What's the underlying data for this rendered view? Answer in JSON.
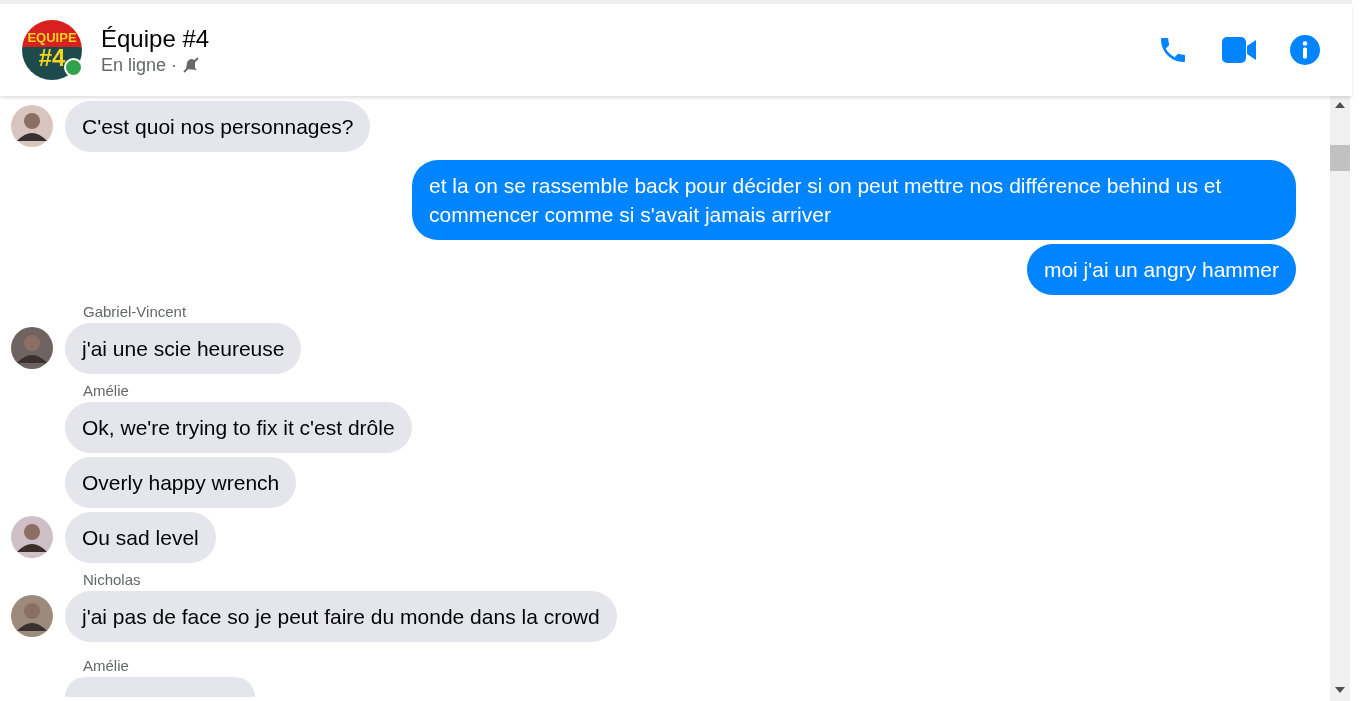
{
  "header": {
    "avatar": {
      "logo_top": "EQUIPE",
      "logo_bottom": "#4",
      "online": true
    },
    "title": "Équipe #4",
    "status": "En ligne ·",
    "muted": true,
    "actions": [
      {
        "kind": "call"
      },
      {
        "kind": "video"
      },
      {
        "kind": "info"
      }
    ]
  },
  "messages": [
    {
      "kind": "received",
      "text": "C'est quoi nos personnages?",
      "avatar": true
    },
    {
      "kind": "sent",
      "text": "et la on se rassemble back pour décider si on peut mettre nos différence behind us et commencer comme si s'avait jamais arriver"
    },
    {
      "kind": "sent",
      "text": "moi j'ai un angry hammer"
    },
    {
      "kind": "received",
      "sender": "Gabriel-Vincent",
      "text": "j'ai une scie heureuse",
      "avatar": true
    },
    {
      "kind": "received",
      "sender": "Amélie",
      "text": "Ok, we're trying to fix it c'est drôle",
      "avatar": false
    },
    {
      "kind": "received",
      "text": "Overly happy wrench",
      "avatar": false
    },
    {
      "kind": "received",
      "text": "Ou sad level",
      "avatar": true
    },
    {
      "kind": "received",
      "sender": "Nicholas",
      "text": "j'ai pas de face so je peut faire du monde dans la crowd",
      "avatar": true
    },
    {
      "kind": "received",
      "sender": "Amélie",
      "avatar": false
    }
  ]
}
